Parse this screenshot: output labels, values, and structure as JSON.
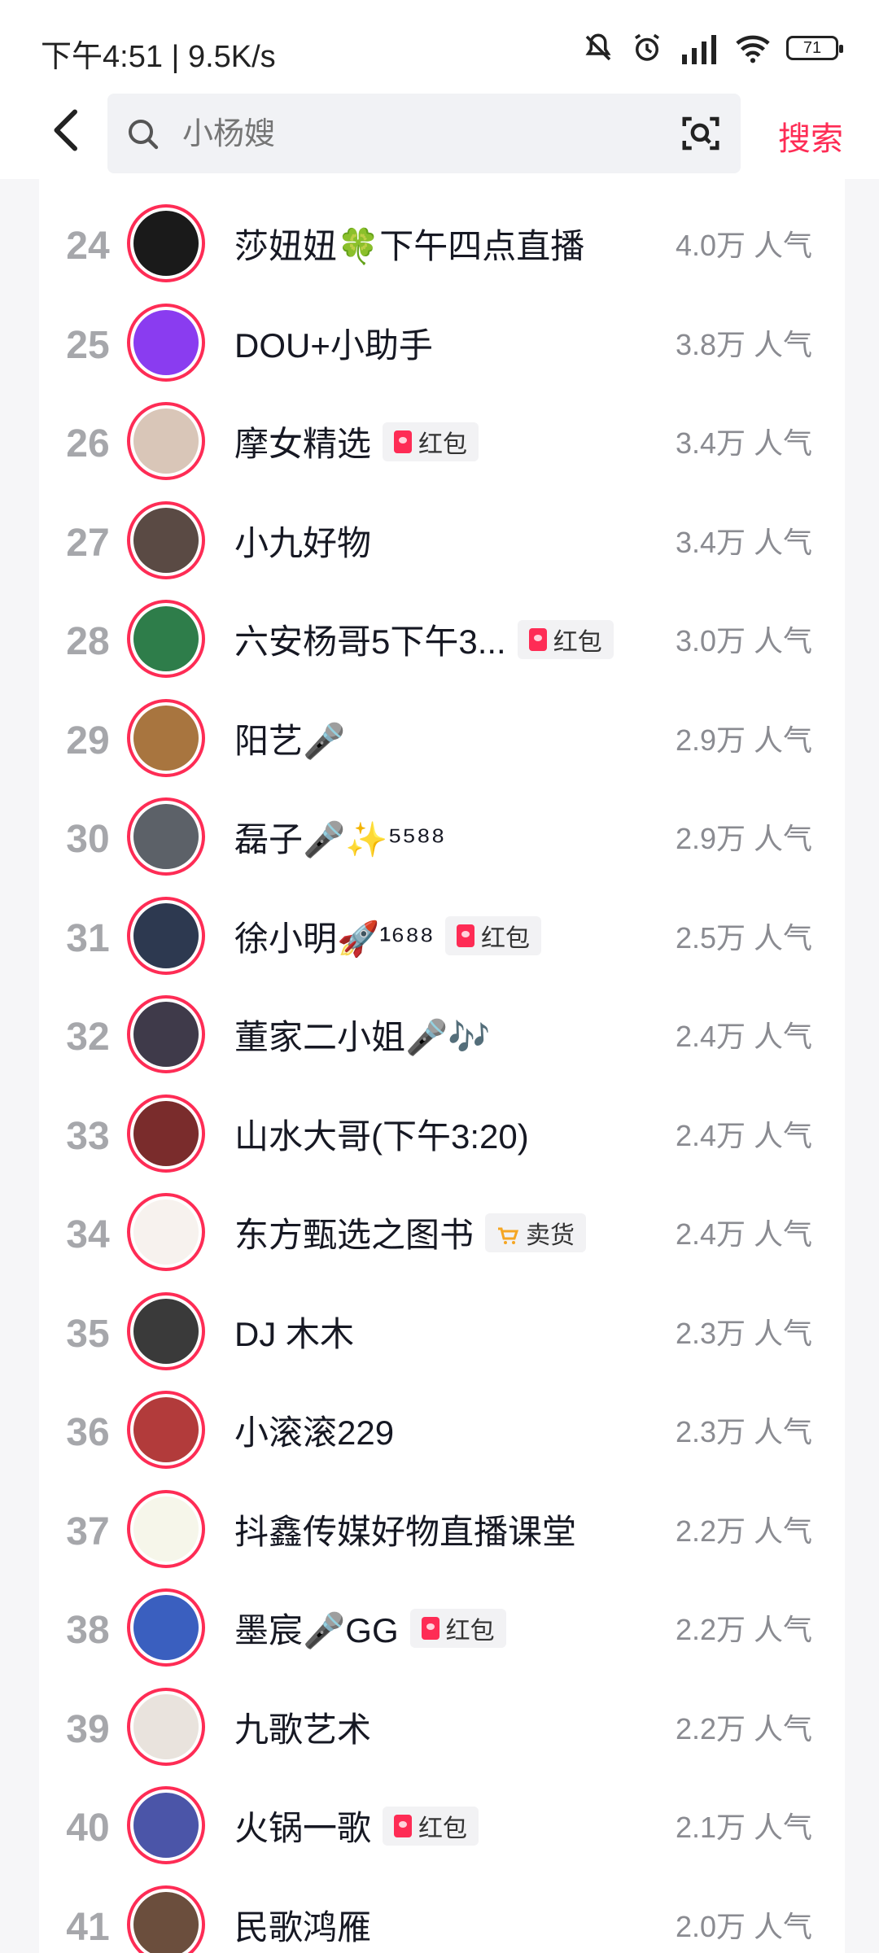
{
  "status_bar": {
    "time": "下午4:51 | 9.5K/s",
    "battery": "71"
  },
  "search": {
    "placeholder": "小杨嫂",
    "button": "搜索"
  },
  "list": [
    {
      "rank": "24",
      "name": "莎妞妞🍀下午四点直播",
      "badge": "",
      "popularity": "4.0万 人气",
      "avatar_color": "#1a1a1a"
    },
    {
      "rank": "25",
      "name": "DOU+小助手",
      "badge": "",
      "popularity": "3.8万 人气",
      "avatar_color": "#8a3cf0"
    },
    {
      "rank": "26",
      "name": "摩女精选",
      "badge": "红包",
      "badge_type": "redpacket",
      "popularity": "3.4万 人气",
      "avatar_color": "#d9c6b8"
    },
    {
      "rank": "27",
      "name": "小九好物",
      "badge": "",
      "popularity": "3.4万 人气",
      "avatar_color": "#5a4a44"
    },
    {
      "rank": "28",
      "name": "六安杨哥5下午3...",
      "badge": "红包",
      "badge_type": "redpacket",
      "popularity": "3.0万 人气",
      "avatar_color": "#2e7d4a"
    },
    {
      "rank": "29",
      "name": "阳艺🎤",
      "badge": "",
      "popularity": "2.9万 人气",
      "avatar_color": "#a8753f"
    },
    {
      "rank": "30",
      "name": "磊子🎤✨⁵⁵⁸⁸",
      "badge": "",
      "popularity": "2.9万 人气",
      "avatar_color": "#5c6168"
    },
    {
      "rank": "31",
      "name": "徐小明🚀¹⁶⁸⁸",
      "badge": "红包",
      "badge_type": "redpacket",
      "popularity": "2.5万 人气",
      "avatar_color": "#2d3950"
    },
    {
      "rank": "32",
      "name": "董家二小姐🎤🎶",
      "badge": "",
      "popularity": "2.4万 人气",
      "avatar_color": "#3f3a4a"
    },
    {
      "rank": "33",
      "name": "山水大哥(下午3:20)",
      "badge": "",
      "popularity": "2.4万 人气",
      "avatar_color": "#7a2c2c"
    },
    {
      "rank": "34",
      "name": "东方甄选之图书",
      "badge": "卖货",
      "badge_type": "shop",
      "popularity": "2.4万 人气",
      "avatar_color": "#f7f2ee"
    },
    {
      "rank": "35",
      "name": "DJ 木木",
      "badge": "",
      "popularity": "2.3万 人气",
      "avatar_color": "#3a3a3a"
    },
    {
      "rank": "36",
      "name": "小滚滚229",
      "badge": "",
      "popularity": "2.3万 人气",
      "avatar_color": "#b23b3b"
    },
    {
      "rank": "37",
      "name": "抖鑫传媒好物直播课堂",
      "badge": "",
      "popularity": "2.2万 人气",
      "avatar_color": "#f6f6ea"
    },
    {
      "rank": "38",
      "name": "墨宸🎤GG",
      "badge": "红包",
      "badge_type": "redpacket",
      "popularity": "2.2万 人气",
      "avatar_color": "#3a5fbf"
    },
    {
      "rank": "39",
      "name": "九歌艺术",
      "badge": "",
      "popularity": "2.2万 人气",
      "avatar_color": "#e9e3dd"
    },
    {
      "rank": "40",
      "name": "火锅一歌",
      "badge": "红包",
      "badge_type": "redpacket",
      "popularity": "2.1万 人气",
      "avatar_color": "#4b55a8"
    },
    {
      "rank": "41",
      "name": "民歌鸿雁",
      "badge": "",
      "popularity": "2.0万 人气",
      "avatar_color": "#6b4e3d"
    }
  ]
}
